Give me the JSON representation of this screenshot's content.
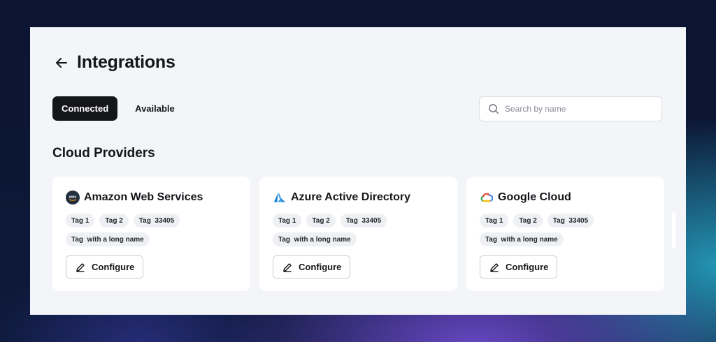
{
  "page": {
    "title": "Integrations",
    "back_icon": "arrow-left-icon"
  },
  "tabs": [
    {
      "label": "Connected",
      "active": true
    },
    {
      "label": "Available",
      "active": false
    }
  ],
  "search": {
    "placeholder": "Search by name",
    "value": "",
    "icon": "search-icon"
  },
  "section": {
    "title": "Cloud Providers"
  },
  "cards": [
    {
      "name": "Amazon Web Services",
      "logo": "aws-logo-icon",
      "tags": [
        "Tag 1",
        "Tag 2",
        "Tag  33405",
        "Tag  with a long name"
      ],
      "configure_label": "Configure",
      "configure_icon": "pencil-icon"
    },
    {
      "name": "Azure Active Directory",
      "logo": "azure-logo-icon",
      "tags": [
        "Tag 1",
        "Tag 2",
        "Tag  33405",
        "Tag  with a long name"
      ],
      "configure_label": "Configure",
      "configure_icon": "pencil-icon"
    },
    {
      "name": "Google Cloud",
      "logo": "google-cloud-logo-icon",
      "tags": [
        "Tag 1",
        "Tag 2",
        "Tag  33405",
        "Tag  with a long name"
      ],
      "configure_label": "Configure",
      "configure_icon": "pencil-icon"
    }
  ],
  "colors": {
    "primary_dark": "#15161a",
    "panel_background": "#f4f5f8",
    "card_background": "#ffffff",
    "tag_background": "#eef0f4",
    "azure_blue": "#0078d4"
  }
}
